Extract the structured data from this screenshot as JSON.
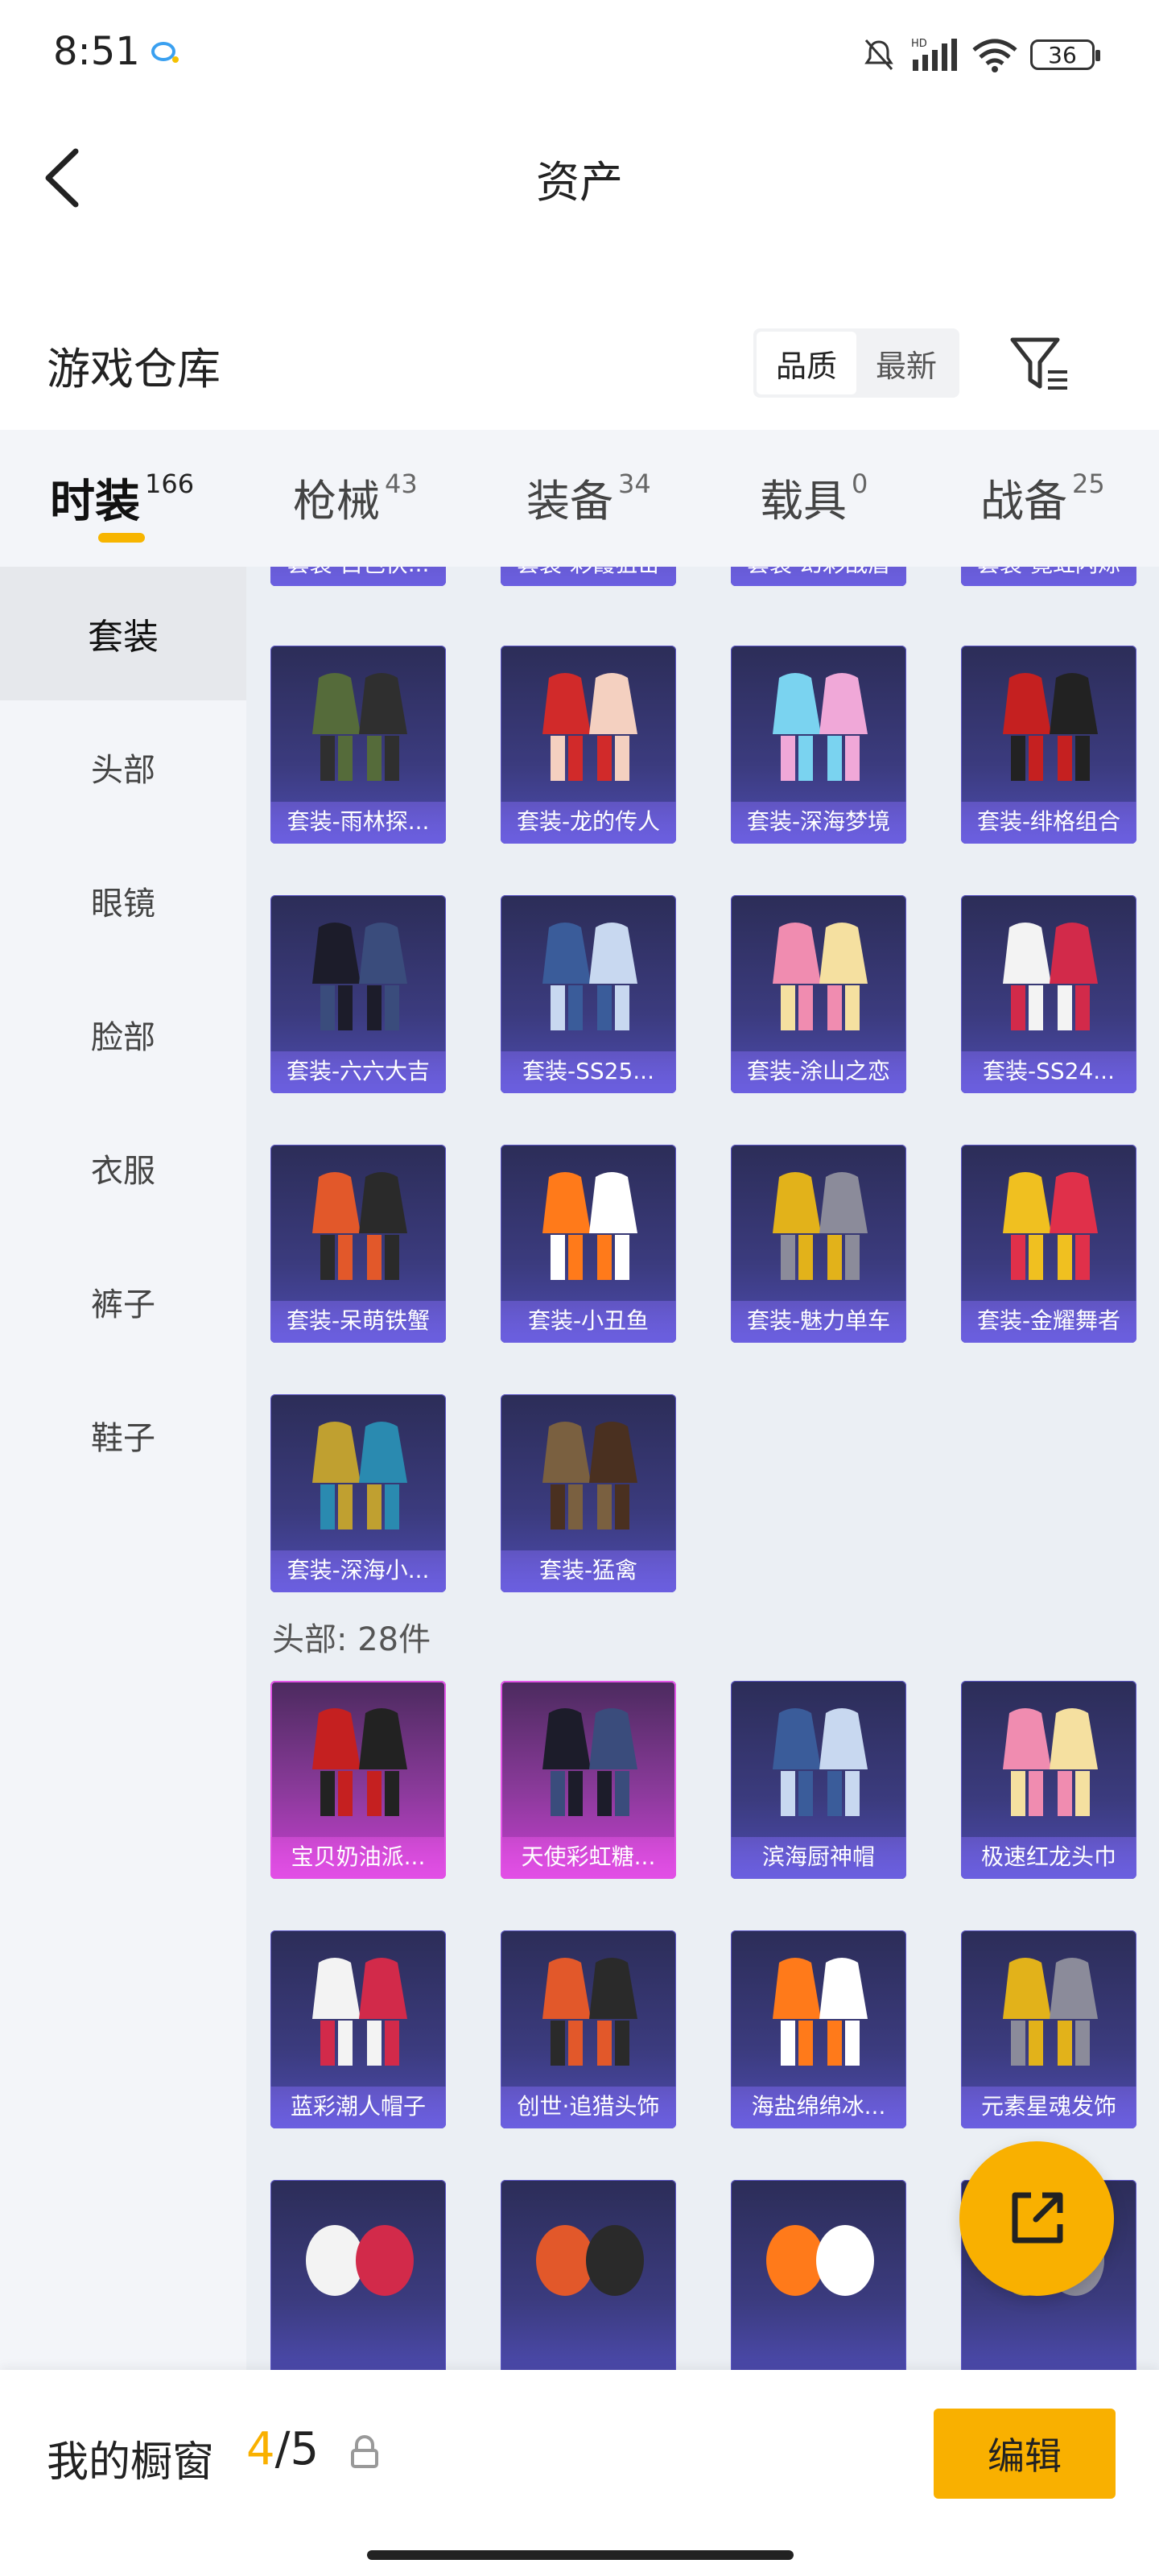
{
  "status_bar": {
    "time": "8:51",
    "battery": "36"
  },
  "header": {
    "title": "资产"
  },
  "warehouse": {
    "title": "游戏仓库",
    "sort_options": [
      "品质",
      "最新"
    ],
    "active_sort": "品质"
  },
  "tabs": [
    {
      "label": "时装",
      "count": "166",
      "active": true
    },
    {
      "label": "枪械",
      "count": "43",
      "active": false
    },
    {
      "label": "装备",
      "count": "34",
      "active": false
    },
    {
      "label": "载具",
      "count": "0",
      "active": false
    },
    {
      "label": "战备",
      "count": "25",
      "active": false
    }
  ],
  "sidebar": {
    "items": [
      {
        "label": "套装",
        "active": true
      },
      {
        "label": "头部",
        "active": false
      },
      {
        "label": "眼镜",
        "active": false
      },
      {
        "label": "脸部",
        "active": false
      },
      {
        "label": "衣服",
        "active": false
      },
      {
        "label": "裤子",
        "active": false
      },
      {
        "label": "鞋子",
        "active": false
      }
    ]
  },
  "items": {
    "partial_row": [
      "套装-白色伏...",
      "套装-彩霞狙击",
      "套装-幻彩战盾",
      "套装-霓虹闪烁"
    ],
    "suits": [
      "套装-雨林探...",
      "套装-龙的传人",
      "套装-深海梦境",
      "套装-绯格组合",
      "套装-六六大吉",
      "套装-SS25...",
      "套装-涂山之恋",
      "套装-SS24...",
      "套装-呆萌铁蟹",
      "套装-小丑鱼",
      "套装-魅力单车",
      "套装-金耀舞者",
      "套装-深海小...",
      "套装-猛禽"
    ],
    "head_section_title": "头部: 28件",
    "head": [
      {
        "name": "宝贝奶油派...",
        "rarity": "pink"
      },
      {
        "name": "天使彩虹糖...",
        "rarity": "pink"
      },
      {
        "name": "滨海厨神帽",
        "rarity": "purple"
      },
      {
        "name": "极速红龙头巾",
        "rarity": "purple"
      },
      {
        "name": "蓝彩潮人帽子",
        "rarity": "purple"
      },
      {
        "name": "创世·追猎头饰",
        "rarity": "purple"
      },
      {
        "name": "海盐绵绵冰...",
        "rarity": "purple"
      },
      {
        "name": "元素星魂发饰",
        "rarity": "purple"
      }
    ]
  },
  "bottom_bar": {
    "title": "我的橱窗",
    "current": "4",
    "total": "/5",
    "edit_label": "编辑"
  },
  "colors": {
    "accent": "#f9b000",
    "card_purple": "#3b3b7e",
    "card_pink": "#c63fd0"
  },
  "icons": [
    "back-arrow-icon",
    "filter-icon",
    "lock-icon",
    "share-icon"
  ]
}
